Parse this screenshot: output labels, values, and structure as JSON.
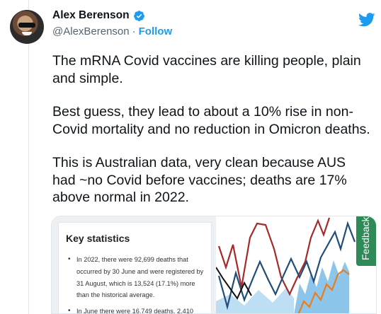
{
  "tweet": {
    "display_name": "Alex Berenson",
    "handle": "@AlexBerenson",
    "separator": "·",
    "follow_label": "Follow",
    "paragraphs": [
      "The mRNA Covid vaccines are killing people, plain and simple.",
      "Best guess, they lead to about a 10% rise in non-Covid mortality and no reduction in Omicron deaths.",
      "This is Australian data, very clean because AUS had ~no Covid before vaccines; deaths are 17% above normal in 2022."
    ]
  },
  "media": {
    "stats_title": "Key statistics",
    "stats_items": [
      "In 2022, there were 92,699 deaths that occurred by 30 June and were registered by 31 August, which is 13,524 (17.1%) more than the historical average.",
      "In June there were 16,749 deaths, 2,410"
    ],
    "feedback_label": "Feedback"
  },
  "colors": {
    "brand_blue": "#1d9bf0",
    "chart_red": "#a52a2a",
    "chart_navy": "#1f4e79",
    "chart_band": "#5dade2",
    "chart_orange": "#e67e22",
    "feedback_green": "#2e8b57"
  }
}
